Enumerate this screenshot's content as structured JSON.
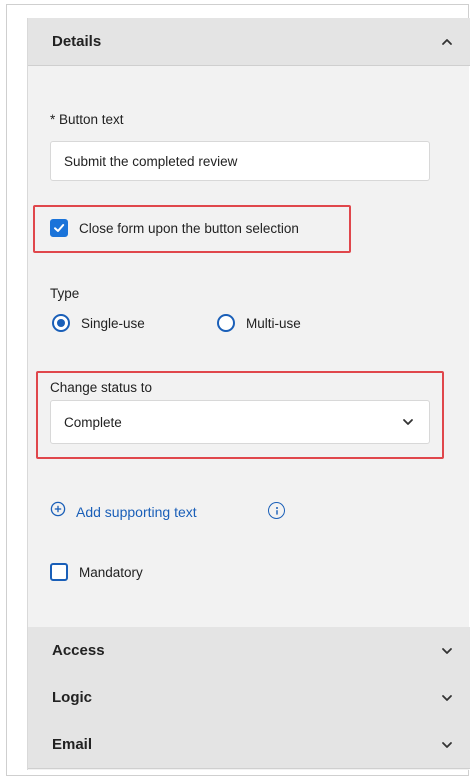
{
  "sections": {
    "details": {
      "title": "Details",
      "expanded": true,
      "chevron_icon": "chevron-up-icon"
    },
    "access": {
      "title": "Access",
      "expanded": false,
      "chevron_icon": "chevron-down-icon"
    },
    "logic": {
      "title": "Logic",
      "expanded": false,
      "chevron_icon": "chevron-down-icon"
    },
    "email": {
      "title": "Email",
      "expanded": false,
      "chevron_icon": "chevron-down-icon"
    }
  },
  "button_text": {
    "label": "* Button text",
    "value": "Submit the completed review"
  },
  "close_form": {
    "label": "Close form upon the button selection",
    "checked": true
  },
  "type": {
    "label": "Type",
    "options": [
      {
        "label": "Single-use",
        "selected": true
      },
      {
        "label": "Multi-use",
        "selected": false
      }
    ]
  },
  "change_status": {
    "label": "Change status to",
    "selected": "Complete"
  },
  "supporting_text": {
    "label": "Add supporting text",
    "icon": "plus-circle-icon",
    "info_icon": "info-icon"
  },
  "mandatory": {
    "label": "Mandatory",
    "checked": false
  },
  "colors": {
    "accent": "#1a73d9",
    "link": "#1a5fb8",
    "highlight": "#e0474c",
    "panel_bg": "#f2f2f2",
    "header_bg": "#e4e4e4"
  }
}
